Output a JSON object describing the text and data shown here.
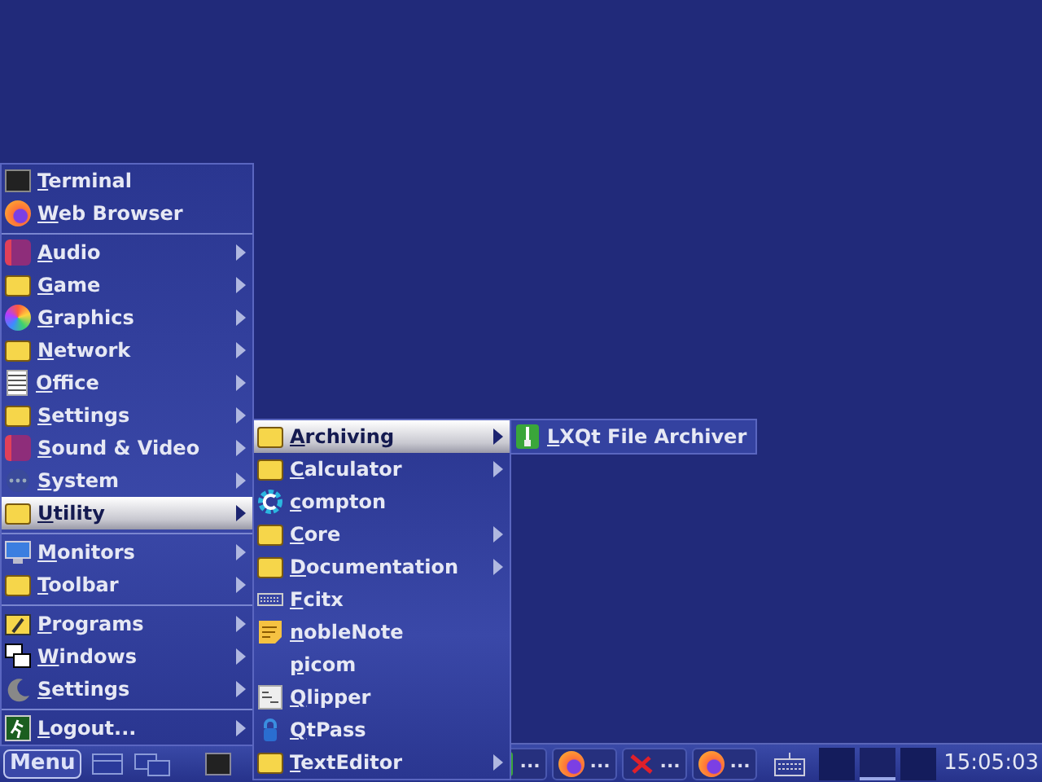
{
  "main_menu": {
    "sections": [
      [
        {
          "label": "Terminal",
          "kind": "terminal",
          "submenu": false,
          "selected": false
        },
        {
          "label": "Web Browser",
          "kind": "browser",
          "submenu": false,
          "selected": false
        }
      ],
      [
        {
          "label": "Audio",
          "kind": "media",
          "submenu": true,
          "selected": false
        },
        {
          "label": "Game",
          "kind": "folder",
          "submenu": true,
          "selected": false
        },
        {
          "label": "Graphics",
          "kind": "graphics",
          "submenu": true,
          "selected": false
        },
        {
          "label": "Network",
          "kind": "folder",
          "submenu": true,
          "selected": false
        },
        {
          "label": "Office",
          "kind": "document",
          "submenu": true,
          "selected": false
        },
        {
          "label": "Settings",
          "kind": "folder",
          "submenu": true,
          "selected": false
        },
        {
          "label": "Sound & Video",
          "kind": "media",
          "submenu": true,
          "selected": false
        },
        {
          "label": "System",
          "kind": "dots",
          "submenu": true,
          "selected": false
        },
        {
          "label": "Utility",
          "kind": "folder",
          "submenu": true,
          "selected": true
        }
      ],
      [
        {
          "label": "Monitors",
          "kind": "monitor",
          "submenu": true,
          "selected": false
        },
        {
          "label": "Toolbar",
          "kind": "folder",
          "submenu": true,
          "selected": false
        }
      ],
      [
        {
          "label": "Programs",
          "kind": "programs",
          "submenu": true,
          "selected": false
        },
        {
          "label": "Windows",
          "kind": "windows",
          "submenu": true,
          "selected": false
        },
        {
          "label": "Settings",
          "kind": "moon",
          "submenu": true,
          "selected": false
        }
      ],
      [
        {
          "label": "Logout...",
          "kind": "exit",
          "submenu": true,
          "selected": false
        }
      ]
    ]
  },
  "utility_menu": {
    "items": [
      {
        "label": "Archiving",
        "kind": "folder",
        "submenu": true,
        "selected": true
      },
      {
        "label": "Calculator",
        "kind": "folder",
        "submenu": true,
        "selected": false
      },
      {
        "label": "compton",
        "kind": "gear",
        "submenu": false,
        "selected": false
      },
      {
        "label": "Core",
        "kind": "folder",
        "submenu": true,
        "selected": false
      },
      {
        "label": "Documentation",
        "kind": "folder",
        "submenu": true,
        "selected": false
      },
      {
        "label": "Fcitx",
        "kind": "keyboard",
        "submenu": false,
        "selected": false
      },
      {
        "label": "nobleNote",
        "kind": "note",
        "submenu": false,
        "selected": false
      },
      {
        "label": "picom",
        "kind": "none",
        "submenu": false,
        "selected": false
      },
      {
        "label": "Qlipper",
        "kind": "clipboard",
        "submenu": false,
        "selected": false
      },
      {
        "label": "QtPass",
        "kind": "lock",
        "submenu": false,
        "selected": false
      },
      {
        "label": "TextEditor",
        "kind": "folder",
        "submenu": true,
        "selected": false
      }
    ]
  },
  "archiving_menu": {
    "items": [
      {
        "label": "LXQt File Archiver",
        "kind": "archive",
        "submenu": false,
        "selected": false
      }
    ]
  },
  "taskbar": {
    "menu_button": "Menu",
    "tasks": [
      {
        "label": "...",
        "kind": "archive"
      },
      {
        "label": "...",
        "kind": "browser"
      },
      {
        "label": "...",
        "kind": "cross"
      },
      {
        "label": "...",
        "kind": "browser"
      }
    ],
    "desktops": [
      {
        "selected": false
      },
      {
        "selected": true
      },
      {
        "selected": false
      }
    ],
    "clock": "15:05:03"
  }
}
